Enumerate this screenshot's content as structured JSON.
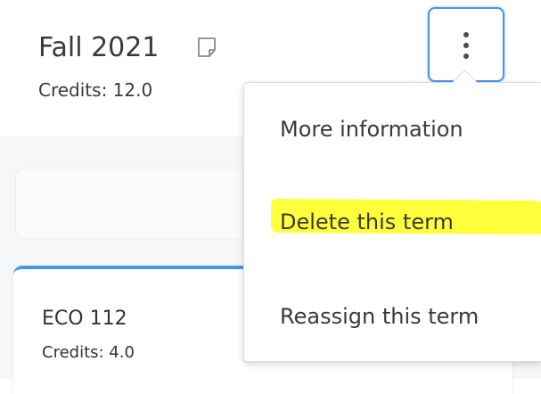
{
  "term": {
    "title": "Fall 2021",
    "credits": "Credits:  12.0",
    "note_icon": "note-icon",
    "more_options_icon": "vertical-ellipsis-icon"
  },
  "course": {
    "code": "ECO 112",
    "credits": "Credits: 4.0"
  },
  "menu": {
    "items": [
      {
        "label": "More information"
      },
      {
        "label": "Delete this term",
        "highlighted": true
      },
      {
        "label": "Reassign this term"
      }
    ]
  },
  "colors": {
    "accent": "#4a95e6",
    "highlight": "#ffff3b",
    "text": "#3a3a3a",
    "background": "#f6f7f8"
  }
}
